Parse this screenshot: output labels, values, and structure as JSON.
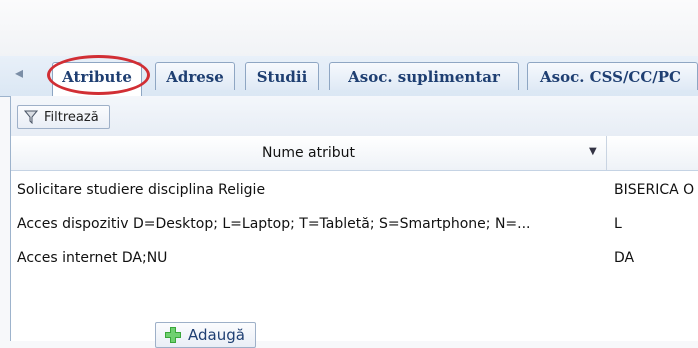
{
  "tabs": [
    {
      "label": "Atribute",
      "active": true
    },
    {
      "label": "Adrese",
      "active": false
    },
    {
      "label": "Studii",
      "active": false
    },
    {
      "label": "Asoc. suplimentar",
      "active": false
    },
    {
      "label": "Asoc. CSS/CC/PC",
      "active": false
    }
  ],
  "toolbar": {
    "filter_label": "Filtrează"
  },
  "grid": {
    "columns": [
      {
        "label": "Nume atribut"
      },
      {
        "label": ""
      }
    ],
    "rows": [
      {
        "name": "Solicitare studiere disciplina Religie",
        "value": "BISERICA O"
      },
      {
        "name": "Acces dispozitiv D=Desktop; L=Laptop; T=Tabletă; S=Smartphone; N=...",
        "value": "L"
      },
      {
        "name": "Acces internet DA;NU",
        "value": "DA"
      }
    ]
  },
  "footer": {
    "add_label": "Adaugă"
  },
  "colors": {
    "accent_highlight": "#d12e34",
    "tab_text": "#1f3f72",
    "add_icon": "#3aa63a"
  },
  "icons": {
    "scroll_left": "chevron-left-icon",
    "filter": "filter-icon",
    "sort": "sort-down-icon",
    "add": "plus-icon"
  }
}
